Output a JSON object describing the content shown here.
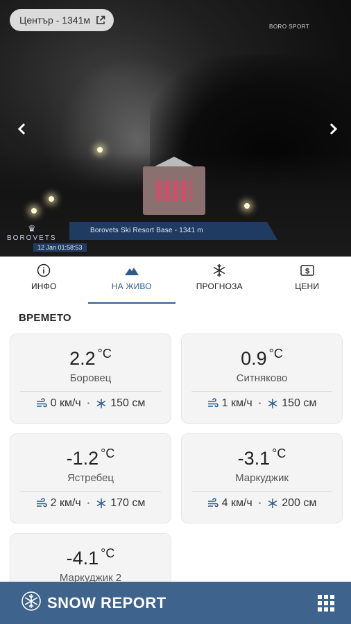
{
  "webcam": {
    "location_label": "Център - 1341м",
    "overlay_caption": "Borovets Ski Resort Base - 1341 m",
    "timestamp": "12 Jan 01:58:53",
    "watermark_bottom_left": "BOROVETS",
    "watermark_top_right": "BORO SPORT",
    "icons": {
      "external_link": "external-link-icon",
      "prev": "chevron-left-icon",
      "next": "chevron-right-icon"
    }
  },
  "tabs": [
    {
      "label": "ИНФО",
      "icon": "info-icon",
      "active": false
    },
    {
      "label": "НА ЖИВО",
      "icon": "mountain-icon",
      "active": true
    },
    {
      "label": "ПРОГНОЗА",
      "icon": "snowflake-icon",
      "active": false
    },
    {
      "label": "ЦЕНИ",
      "icon": "price-tag-icon",
      "active": false
    }
  ],
  "weather": {
    "section_title": "ВРЕМЕТО",
    "stations": [
      {
        "temp": "2.2",
        "unit": "°C",
        "name": "Боровец",
        "wind": "0 км/ч",
        "snow": "150 см"
      },
      {
        "temp": "0.9",
        "unit": "°C",
        "name": "Ситняково",
        "wind": "1 км/ч",
        "snow": "150 см"
      },
      {
        "temp": "-1.2",
        "unit": "°C",
        "name": "Ястребец",
        "wind": "2 км/ч",
        "snow": "170 см"
      },
      {
        "temp": "-3.1",
        "unit": "°C",
        "name": "Маркуджик",
        "wind": "4 км/ч",
        "snow": "200 см"
      },
      {
        "temp": "-4.1",
        "unit": "°C",
        "name": "Маркуджик 2",
        "wind": "",
        "snow": ""
      }
    ]
  },
  "bottom_bar": {
    "brand": "SNOW REPORT",
    "brand_icon": "snowflake-logo-icon",
    "menu_icon": "grid-menu-icon",
    "color": "#3e638c"
  },
  "colors": {
    "accent": "#2c5c8c"
  }
}
